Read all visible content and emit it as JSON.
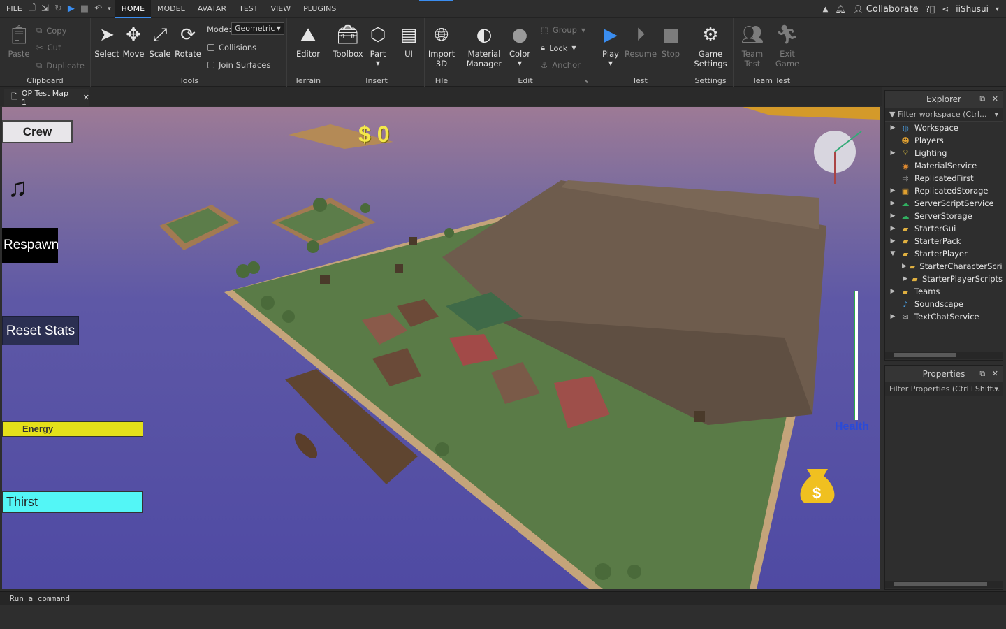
{
  "menu": {
    "file": "FILE",
    "tabs": [
      "HOME",
      "MODEL",
      "AVATAR",
      "TEST",
      "VIEW",
      "PLUGINS"
    ],
    "active_tab": "HOME",
    "collaborate": "Collaborate",
    "username": "iiShusui"
  },
  "ribbon": {
    "clipboard": {
      "title": "Clipboard",
      "paste": "Paste",
      "copy": "Copy",
      "cut": "Cut",
      "duplicate": "Duplicate"
    },
    "tools": {
      "title": "Tools",
      "select": "Select",
      "move": "Move",
      "scale": "Scale",
      "rotate": "Rotate",
      "mode_label": "Mode:",
      "mode_value": "Geometric",
      "collisions": "Collisions",
      "join_surfaces": "Join Surfaces"
    },
    "terrain": {
      "title": "Terrain",
      "editor": "Editor"
    },
    "insert": {
      "title": "Insert",
      "toolbox": "Toolbox",
      "part": "Part",
      "ui": "UI"
    },
    "file": {
      "title": "File",
      "import3d": "Import 3D"
    },
    "edit": {
      "title": "Edit",
      "material_manager": "Material Manager",
      "color": "Color",
      "group": "Group",
      "lock": "Lock",
      "anchor": "Anchor"
    },
    "test": {
      "title": "Test",
      "play": "Play",
      "resume": "Resume",
      "stop": "Stop"
    },
    "settings": {
      "title": "Settings",
      "game_settings": "Game Settings"
    },
    "team_test": {
      "title": "Team Test",
      "team_test_btn": "Team Test",
      "exit_game": "Exit Game"
    }
  },
  "document_tab": {
    "label": "OP Test Map 1"
  },
  "hud": {
    "crew": "Crew",
    "respawn": "Respawn",
    "reset_stats": "Reset Stats",
    "energy": "Energy",
    "energy_level": 1.0,
    "thirst": "Thirst",
    "thirst_level": 1.0,
    "money": "$ 0",
    "health": "Health",
    "health_level": 1.0
  },
  "explorer": {
    "title": "Explorer",
    "filter_placeholder": "Filter workspace (Ctrl...",
    "items": [
      {
        "label": "Workspace",
        "expander": "▶",
        "icon": "globe-icon",
        "color": "#4a9ee0"
      },
      {
        "label": "Players",
        "expander": "",
        "icon": "players-icon",
        "color": "#e0a030"
      },
      {
        "label": "Lighting",
        "expander": "▶",
        "icon": "bulb-icon",
        "color": "#f0d040"
      },
      {
        "label": "MaterialService",
        "expander": "",
        "icon": "material-icon",
        "color": "#e08a30"
      },
      {
        "label": "ReplicatedFirst",
        "expander": "",
        "icon": "replicated-icon",
        "color": "#b0b0b0"
      },
      {
        "label": "ReplicatedStorage",
        "expander": "▶",
        "icon": "storage-icon",
        "color": "#e0a030"
      },
      {
        "label": "ServerScriptService",
        "expander": "▶",
        "icon": "server-icon",
        "color": "#30b060"
      },
      {
        "label": "ServerStorage",
        "expander": "▶",
        "icon": "server-storage-icon",
        "color": "#30b060"
      },
      {
        "label": "StarterGui",
        "expander": "▶",
        "icon": "folder-icon",
        "color": "#e0b040"
      },
      {
        "label": "StarterPack",
        "expander": "▶",
        "icon": "folder-icon",
        "color": "#e0b040"
      },
      {
        "label": "StarterPlayer",
        "expander": "▼",
        "icon": "folder-icon",
        "color": "#e0b040"
      },
      {
        "label": "StarterCharacterScripts",
        "expander": "▶",
        "icon": "folder-icon",
        "color": "#e0b040",
        "indent": 1
      },
      {
        "label": "StarterPlayerScripts",
        "expander": "▶",
        "icon": "folder-icon",
        "color": "#e0b040",
        "indent": 1
      },
      {
        "label": "Teams",
        "expander": "▶",
        "icon": "folder-icon",
        "color": "#e0b040"
      },
      {
        "label": "Soundscape",
        "expander": "",
        "icon": "sound-icon",
        "color": "#4a9ee0"
      },
      {
        "label": "TextChatService",
        "expander": "▶",
        "icon": "chat-icon",
        "color": "#c0c0c0"
      }
    ]
  },
  "properties": {
    "title": "Properties",
    "filter_placeholder": "Filter Properties (Ctrl+Shift..."
  },
  "command_bar": {
    "placeholder": "Run a command"
  }
}
